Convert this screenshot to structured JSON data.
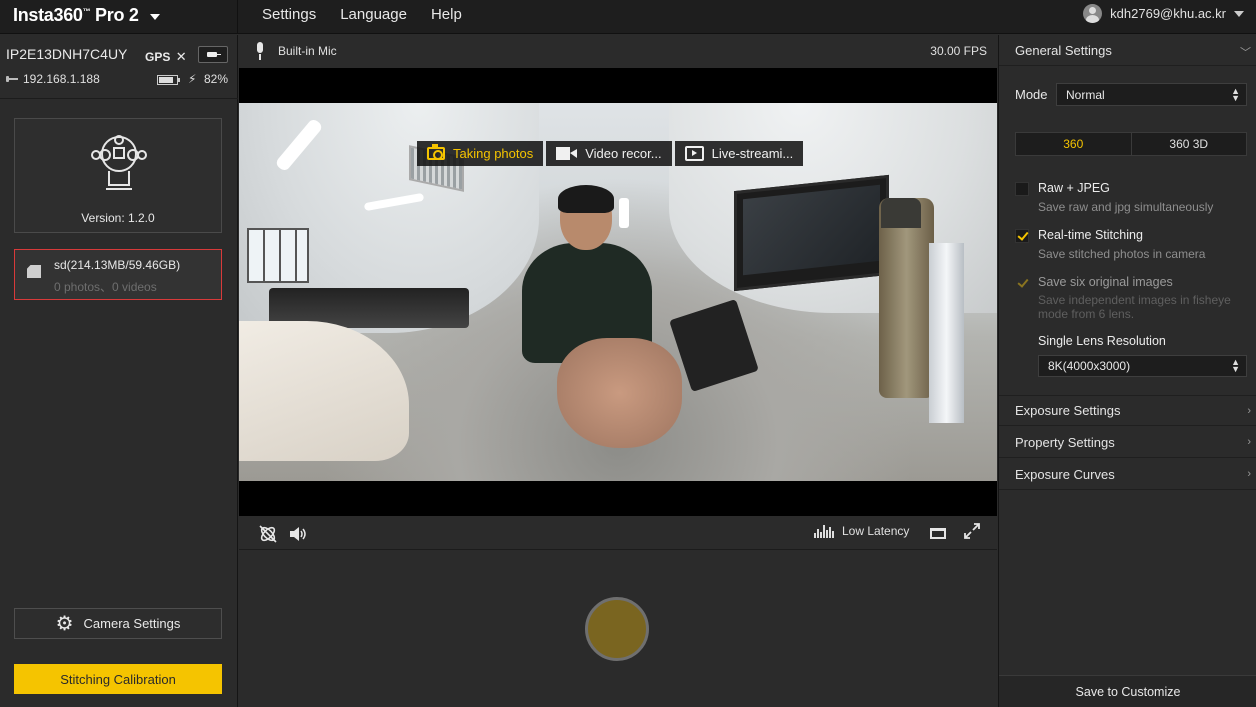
{
  "app": {
    "logo": "Insta360",
    "logo_tm": "™",
    "logo_model": " Pro 2",
    "menu": [
      "Settings",
      "Language",
      "Help"
    ],
    "user": "kdh2769@khu.ac.kr"
  },
  "device": {
    "id": "IP2E13DNH7C4UY",
    "gps_label": "GPS",
    "gps_status": "✕",
    "ip": "192.168.1.188",
    "battery_percent": "82%",
    "battery_level": 0.82,
    "version": "Version:  1.2.0"
  },
  "storage": {
    "title": "sd(214.13MB/59.46GB)",
    "counts": "0 photos、0 videos"
  },
  "left_buttons": {
    "camera_settings": "Camera Settings",
    "stitching_calibration": "Stitching Calibration"
  },
  "audio": {
    "mic": "Built-in Mic",
    "fps": "30.00 FPS"
  },
  "capture_modes": [
    {
      "label": "Taking photos",
      "icon": "camera-icon",
      "active": true
    },
    {
      "label": "Video recor...",
      "icon": "video-icon",
      "active": false
    },
    {
      "label": "Live-streami...",
      "icon": "live-icon",
      "active": false
    }
  ],
  "preview_controls": {
    "latency": "Low Latency"
  },
  "settings_panel": {
    "general": "General Settings",
    "mode_label": "Mode",
    "mode_value": "Normal",
    "seg_360": "360",
    "seg_360_3d": "360 3D",
    "options": [
      {
        "title": "Raw + JPEG",
        "sub": "Save raw and jpg simultaneously",
        "checked": false,
        "disabled": false
      },
      {
        "title": "Real-time Stitching",
        "sub": "Save stitched photos in camera",
        "checked": true,
        "disabled": false
      },
      {
        "title": "Save six original images",
        "sub": "Save independent images in fisheye mode from 6 lens.",
        "checked": true,
        "disabled": true
      }
    ],
    "single_lens_label": "Single Lens Resolution",
    "single_lens_value": "8K(4000x3000)",
    "sections": [
      "Exposure Settings",
      "Property Settings",
      "Exposure Curves"
    ],
    "save_button": "Save to Customize"
  },
  "colors": {
    "accent": "#f5c400",
    "error_border": "#d83a3a",
    "background": "#2b2b2b"
  }
}
